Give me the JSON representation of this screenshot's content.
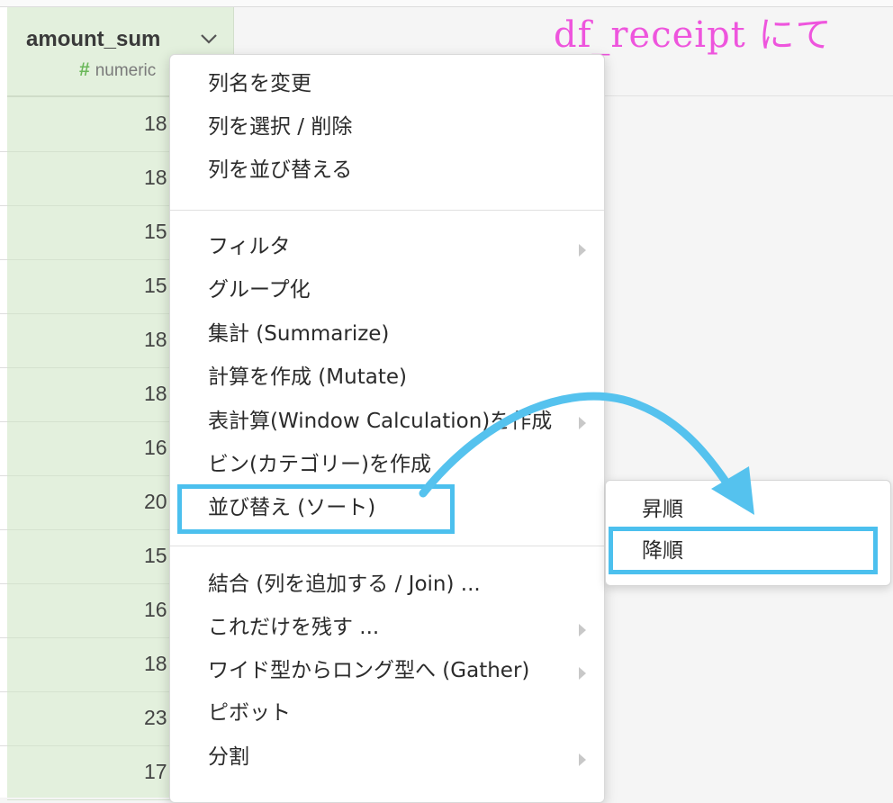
{
  "column": {
    "name": "amount_sum",
    "type_icon": "#",
    "type_label": "numeric",
    "cells": [
      "18",
      "18",
      "15",
      "15",
      "18",
      "18",
      "16",
      "20",
      "15",
      "16",
      "18",
      "23",
      "17"
    ]
  },
  "annotation": "df_receipt にて",
  "menu": {
    "group1": [
      "列名を変更",
      "列を選択 / 削除",
      "列を並び替える"
    ],
    "group2": [
      "フィルタ",
      "グループ化",
      "集計 (Summarize)",
      "計算を作成 (Mutate)",
      "表計算(Window Calculation)を作成",
      "ビン(カテゴリー)を作成",
      "並び替え (ソート)"
    ],
    "group3": [
      "結合 (列を追加する / Join) ...",
      "これだけを残す ...",
      "ワイド型からロング型へ (Gather)",
      "ピボット",
      "分割"
    ]
  },
  "submenu": {
    "items": [
      "昇順",
      "降順"
    ]
  },
  "colors": {
    "column_bg": "#e3f0dd",
    "highlight": "#4cc0ee",
    "annotation": "#ee55dd",
    "type_icon": "#6bb85a"
  },
  "icons": {
    "header_dropdown": "chevron-down-icon",
    "submenu_arrow": "chevron-right-icon"
  }
}
